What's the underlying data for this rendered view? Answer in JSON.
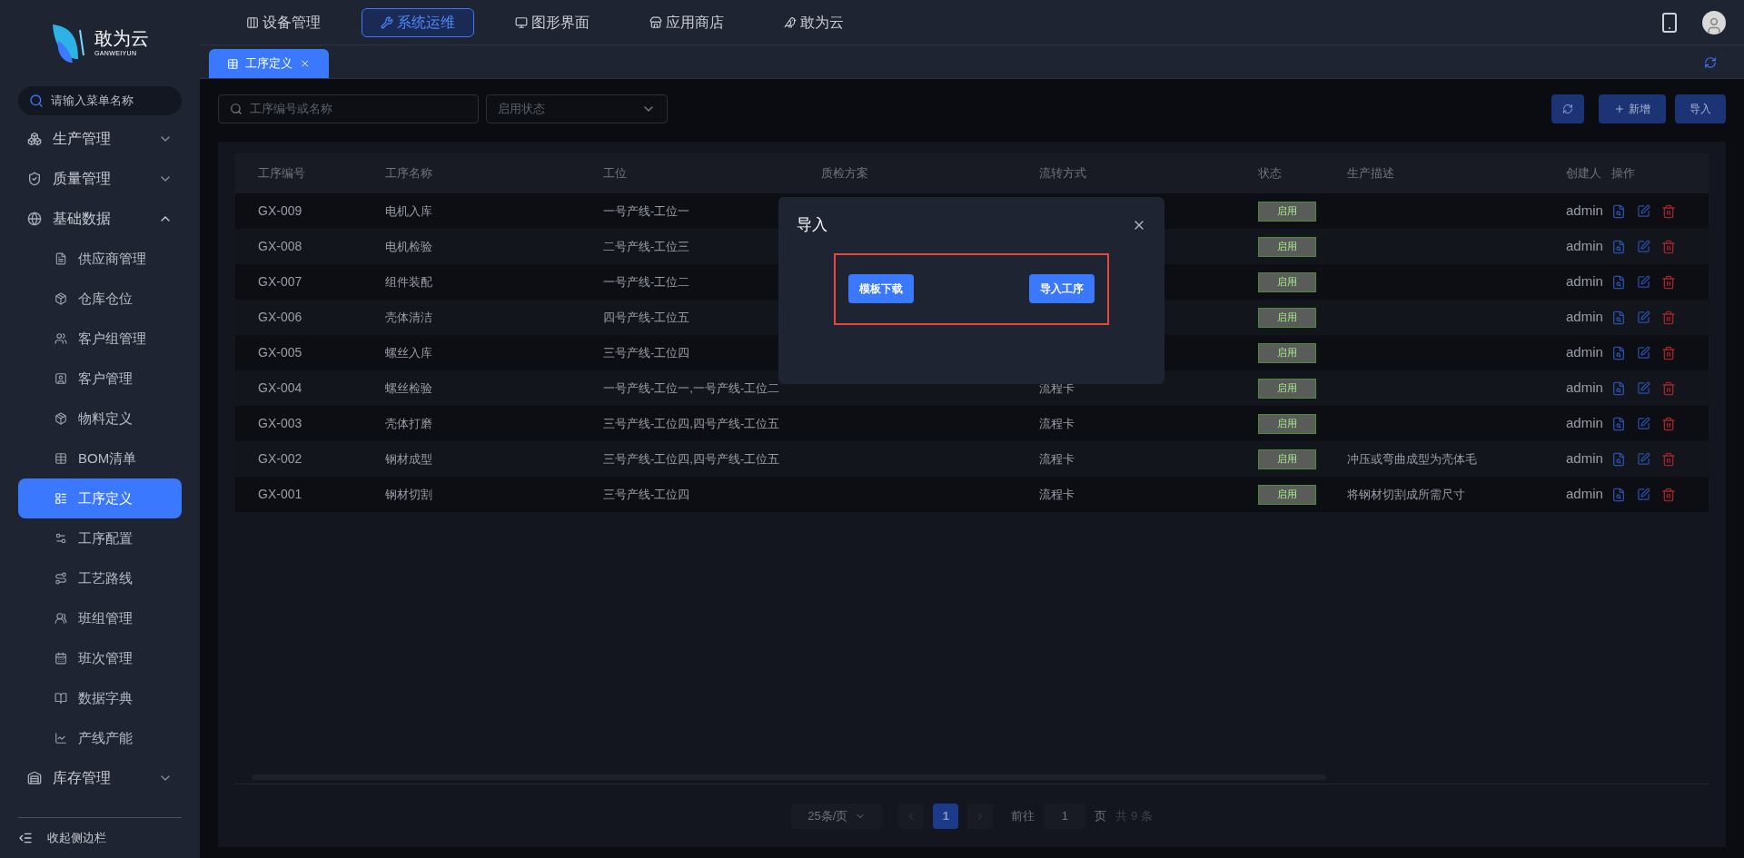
{
  "logo": {
    "name": "敢为云",
    "subtitle": "GANWEIYUN"
  },
  "sidebar": {
    "search_placeholder": "请输入菜单名称",
    "collapse_label": "收起侧边栏",
    "items": [
      {
        "label": "生产管理",
        "expanded": false
      },
      {
        "label": "质量管理",
        "expanded": false
      },
      {
        "label": "基础数据",
        "expanded": true,
        "children": [
          {
            "label": "供应商管理",
            "selected": false
          },
          {
            "label": "仓库仓位",
            "selected": false
          },
          {
            "label": "客户组管理",
            "selected": false
          },
          {
            "label": "客户管理",
            "selected": false
          },
          {
            "label": "物料定义",
            "selected": false
          },
          {
            "label": "BOM清单",
            "selected": false
          },
          {
            "label": "工序定义",
            "selected": true
          },
          {
            "label": "工序配置",
            "selected": false
          },
          {
            "label": "工艺路线",
            "selected": false
          },
          {
            "label": "班组管理",
            "selected": false
          },
          {
            "label": "班次管理",
            "selected": false
          },
          {
            "label": "数据字典",
            "selected": false
          },
          {
            "label": "产线产能",
            "selected": false
          }
        ]
      },
      {
        "label": "库存管理",
        "expanded": false
      }
    ]
  },
  "top_nav": [
    {
      "label": "设备管理",
      "selected": false
    },
    {
      "label": "系统运维",
      "selected": true
    },
    {
      "label": "图形界面",
      "selected": false
    },
    {
      "label": "应用商店",
      "selected": false
    },
    {
      "label": "敢为云",
      "selected": false
    }
  ],
  "tabs": [
    {
      "label": "工序定义",
      "selected": true
    }
  ],
  "toolbar": {
    "search_placeholder": "工序编号或名称",
    "status_placeholder": "启用状态",
    "buttons": [
      {
        "kind": "refresh"
      },
      {
        "kind": "add",
        "label": "新增"
      },
      {
        "kind": "import",
        "label": "导入"
      }
    ]
  },
  "table": {
    "columns": [
      "工序编号",
      "工序名称",
      "工位",
      "质检方案",
      "流转方式",
      "状态",
      "生产描述",
      "创建人",
      "操作"
    ],
    "rows": [
      {
        "code": "GX-009",
        "name": "电机入库",
        "station": "一号产线-工位一",
        "status": "启用",
        "creator": "admin"
      },
      {
        "code": "GX-008",
        "name": "电机检验",
        "station": "二号产线-工位三",
        "status": "启用",
        "creator": "admin"
      },
      {
        "code": "GX-007",
        "name": "组件装配",
        "station": "一号产线-工位二",
        "status": "启用",
        "creator": "admin"
      },
      {
        "code": "GX-006",
        "name": "壳体清洁",
        "station": "四号产线-工位五",
        "status": "启用",
        "creator": "admin"
      },
      {
        "code": "GX-005",
        "name": "螺丝入库",
        "station": "三号产线-工位四",
        "status": "启用",
        "creator": "admin"
      },
      {
        "code": "GX-004",
        "name": "螺丝检验",
        "station": "一号产线-工位一,一号产线-工位二",
        "flow": "流程卡",
        "status": "启用",
        "creator": "admin"
      },
      {
        "code": "GX-003",
        "name": "壳体打磨",
        "station": "三号产线-工位四,四号产线-工位五",
        "flow": "流程卡",
        "status": "启用",
        "creator": "admin"
      },
      {
        "code": "GX-002",
        "name": "钢材成型",
        "station": "三号产线-工位四,四号产线-工位五",
        "flow": "流程卡",
        "status": "启用",
        "description": "冲压或弯曲成型为壳体毛",
        "creator": "admin"
      },
      {
        "code": "GX-001",
        "name": "钢材切割",
        "station": "三号产线-工位四",
        "flow": "流程卡",
        "status": "启用",
        "description": "将钢材切割成所需尺寸",
        "creator": "admin"
      }
    ]
  },
  "pagination": {
    "page_size": "25条/页",
    "pages": [
      {
        "label": "1",
        "selected": true
      }
    ],
    "goto_label": "前往",
    "goto_value": "1",
    "page_unit": "页",
    "total": "共 9 条"
  },
  "dialog": {
    "title": "导入",
    "buttons": [
      "模板下载",
      "导入工序"
    ]
  }
}
